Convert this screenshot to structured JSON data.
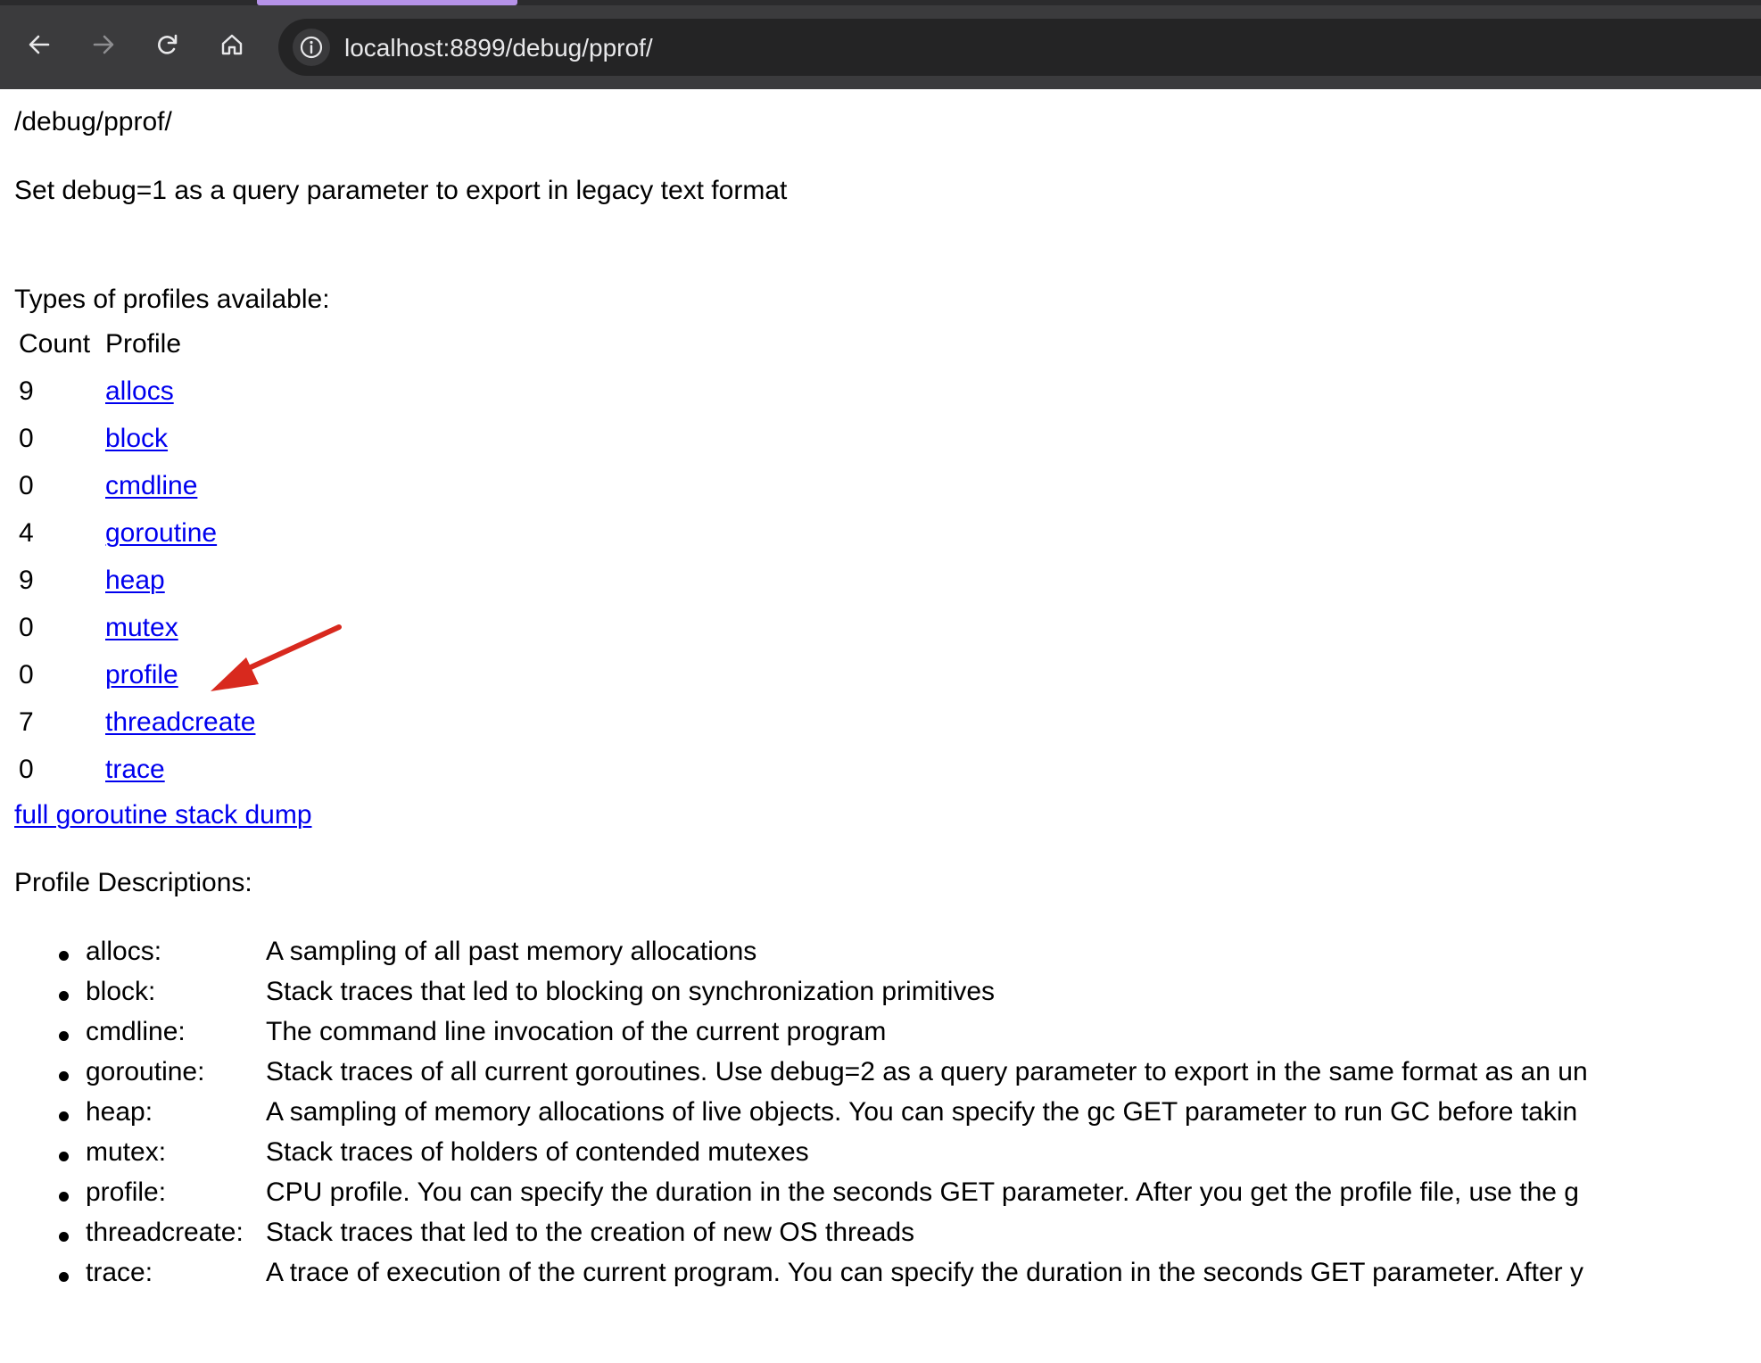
{
  "browser": {
    "url": "localhost:8899/debug/pprof/",
    "icons": {
      "back": "arrow-left-icon",
      "forward": "arrow-right-icon",
      "reload": "reload-icon",
      "home": "home-icon",
      "site_info": "info-icon"
    },
    "colors": {
      "toolbar": "#3b3b3d",
      "omnibox": "#242425",
      "tab_indicator": "#b592e8"
    }
  },
  "page": {
    "heading": "/debug/pprof/",
    "intro": "Set debug=1 as a query parameter to export in legacy text format",
    "types_heading": "Types of profiles available:",
    "table": {
      "headers": [
        "Count",
        "Profile"
      ],
      "rows": [
        {
          "count": "9",
          "profile": "allocs"
        },
        {
          "count": "0",
          "profile": "block"
        },
        {
          "count": "0",
          "profile": "cmdline"
        },
        {
          "count": "4",
          "profile": "goroutine"
        },
        {
          "count": "9",
          "profile": "heap"
        },
        {
          "count": "0",
          "profile": "mutex"
        },
        {
          "count": "0",
          "profile": "profile"
        },
        {
          "count": "7",
          "profile": "threadcreate"
        },
        {
          "count": "0",
          "profile": "trace"
        }
      ]
    },
    "full_dump_link": "full goroutine stack dump",
    "descriptions_heading": "Profile Descriptions:",
    "descriptions": [
      {
        "name": "allocs:",
        "text": "A sampling of all past memory allocations"
      },
      {
        "name": "block:",
        "text": "Stack traces that led to blocking on synchronization primitives"
      },
      {
        "name": "cmdline:",
        "text": "The command line invocation of the current program"
      },
      {
        "name": "goroutine:",
        "text": "Stack traces of all current goroutines. Use debug=2 as a query parameter to export in the same format as an un"
      },
      {
        "name": "heap:",
        "text": "A sampling of memory allocations of live objects. You can specify the gc GET parameter to run GC before takin"
      },
      {
        "name": "mutex:",
        "text": "Stack traces of holders of contended mutexes"
      },
      {
        "name": "profile:",
        "text": "CPU profile. You can specify the duration in the seconds GET parameter. After you get the profile file, use the g"
      },
      {
        "name": "threadcreate:",
        "text": "Stack traces that led to the creation of new OS threads"
      },
      {
        "name": "trace:",
        "text": "A trace of execution of the current program. You can specify the duration in the seconds GET parameter. After y"
      }
    ],
    "link_color": "#0000ee",
    "annotation": {
      "icon": "red-arrow-icon",
      "points_to": "profile",
      "color": "#d8291e"
    }
  }
}
